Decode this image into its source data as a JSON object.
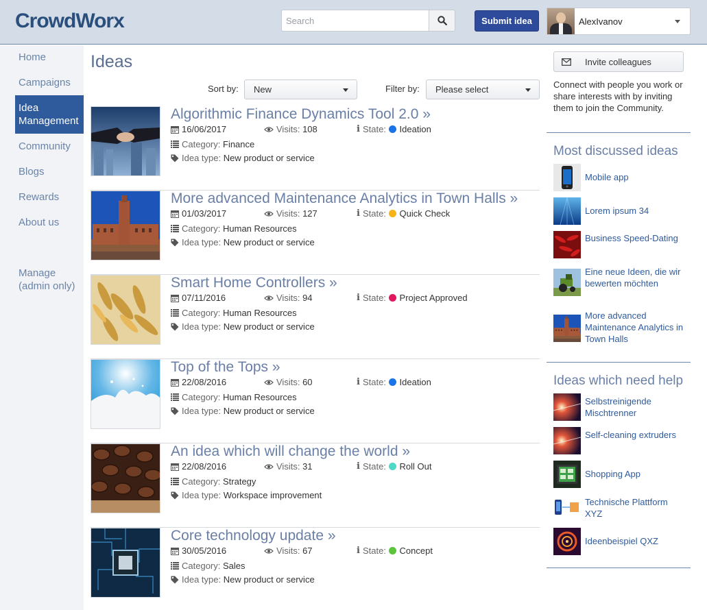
{
  "header": {
    "logo": "CrowdWorx",
    "search_placeholder": "Search",
    "submit_label": "Submit idea",
    "user_name": "AlexIvanov"
  },
  "nav": {
    "items": [
      {
        "label": "Home"
      },
      {
        "label": "Campaigns"
      },
      {
        "label": "Idea Management",
        "active": true
      },
      {
        "label": "Community"
      },
      {
        "label": "Blogs"
      },
      {
        "label": "Rewards"
      },
      {
        "label": "About us"
      }
    ],
    "manage": "Manage (admin only)"
  },
  "main": {
    "title": "Ideas",
    "sort_label": "Sort by:",
    "sort_value": "New",
    "filter_label": "Filter by:",
    "filter_value": "Please select",
    "visits_label": "Visits:",
    "state_label": "State:",
    "category_label": "Category:",
    "type_label": "Idea type:",
    "ideas": [
      {
        "title": "Algorithmic Finance Dynamics Tool 2.0 »",
        "date": "16/06/2017",
        "visits": "108",
        "state": "Ideation",
        "state_color": "#1a73e8",
        "category": "Finance",
        "type": "New product or service",
        "image": "handshake"
      },
      {
        "title": "More advanced Maintenance Analytics in Town Halls »",
        "date": "01/03/2017",
        "visits": "127",
        "state": "Quick Check",
        "state_color": "#f5b316",
        "category": "Human Resources",
        "type": "New product or service",
        "image": "town-hall"
      },
      {
        "title": "Smart Home Controllers »",
        "date": "07/11/2016",
        "visits": "94",
        "state": "Project Approved",
        "state_color": "#e0175e",
        "category": "Human Resources",
        "type": "New product or service",
        "image": "wheat"
      },
      {
        "title": "Top of the Tops »",
        "date": "22/08/2016",
        "visits": "60",
        "state": "Ideation",
        "state_color": "#1a73e8",
        "category": "Human Resources",
        "type": "New product or service",
        "image": "milk-splash"
      },
      {
        "title": "An idea which will change the world »",
        "date": "22/08/2016",
        "visits": "31",
        "state": "Roll Out",
        "state_color": "#4dd8c8",
        "category": "Strategy",
        "type": "Workspace improvement",
        "image": "coffee-beans"
      },
      {
        "title": "Core technology update »",
        "date": "30/05/2016",
        "visits": "67",
        "state": "Concept",
        "state_color": "#5cc43a",
        "category": "Sales",
        "type": "New product or service",
        "image": "circuit-board"
      }
    ]
  },
  "sidebar": {
    "invite_label": "Invite colleagues",
    "invite_text": "Connect with people you work or share interests with by inviting them to join the Community.",
    "discussed_heading": "Most discussed ideas",
    "discussed": [
      {
        "label": "Mobile app",
        "image": "phone"
      },
      {
        "label": "Lorem ipsum 34",
        "image": "underwater"
      },
      {
        "label": "Business Speed-Dating",
        "image": "chili"
      },
      {
        "label": "Eine neue Ideen, die wir bewerten möchten",
        "image": "tractor"
      },
      {
        "label": "More advanced Maintenance Analytics in Town Halls",
        "image": "town-hall"
      }
    ],
    "help_heading": "Ideas which need help",
    "help": [
      {
        "label": "Selbstreinigende Mischtrenner",
        "image": "cosmic"
      },
      {
        "label": "Self-cleaning extruders",
        "image": "cosmic"
      },
      {
        "label": "Shopping App",
        "image": "tablet"
      },
      {
        "label": "Technische Plattform XYZ",
        "image": "devices"
      },
      {
        "label": "Ideenbeispiel QXZ",
        "image": "fractal"
      }
    ]
  }
}
